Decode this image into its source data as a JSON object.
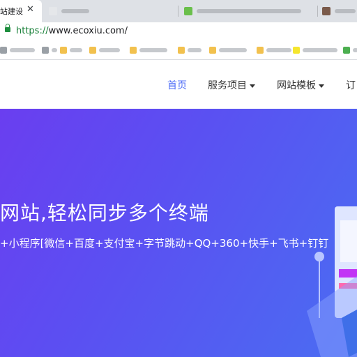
{
  "browser": {
    "active_tab": {
      "title": "站建设",
      "close_glyph": "✕"
    },
    "background_tabs": [
      {
        "title": ""
      },
      {
        "title": ""
      },
      {
        "title": ""
      }
    ],
    "address": {
      "scheme": "https://",
      "rest": "www.ecoxiu.com/"
    }
  },
  "site_nav": {
    "items": [
      {
        "label": "首页",
        "active": true,
        "dropdown": false
      },
      {
        "label": "服务项目",
        "active": false,
        "dropdown": true
      },
      {
        "label": "网站模板",
        "active": false,
        "dropdown": true
      },
      {
        "label": "订",
        "active": false,
        "dropdown": false
      }
    ]
  },
  "hero": {
    "title": "网站,轻松同步多个终端",
    "subtitle": "+小程序[微信+百度+支付宝+字节跳动+QQ+360+快手+飞书+钉钉"
  },
  "colors": {
    "accent": "#4f6ef7",
    "hero_start": "#6a3ef0",
    "hero_end": "#4a6df2",
    "lock_green": "#1e8e3e"
  },
  "icons": [
    "lock-icon",
    "close-icon",
    "caret-down-icon"
  ]
}
